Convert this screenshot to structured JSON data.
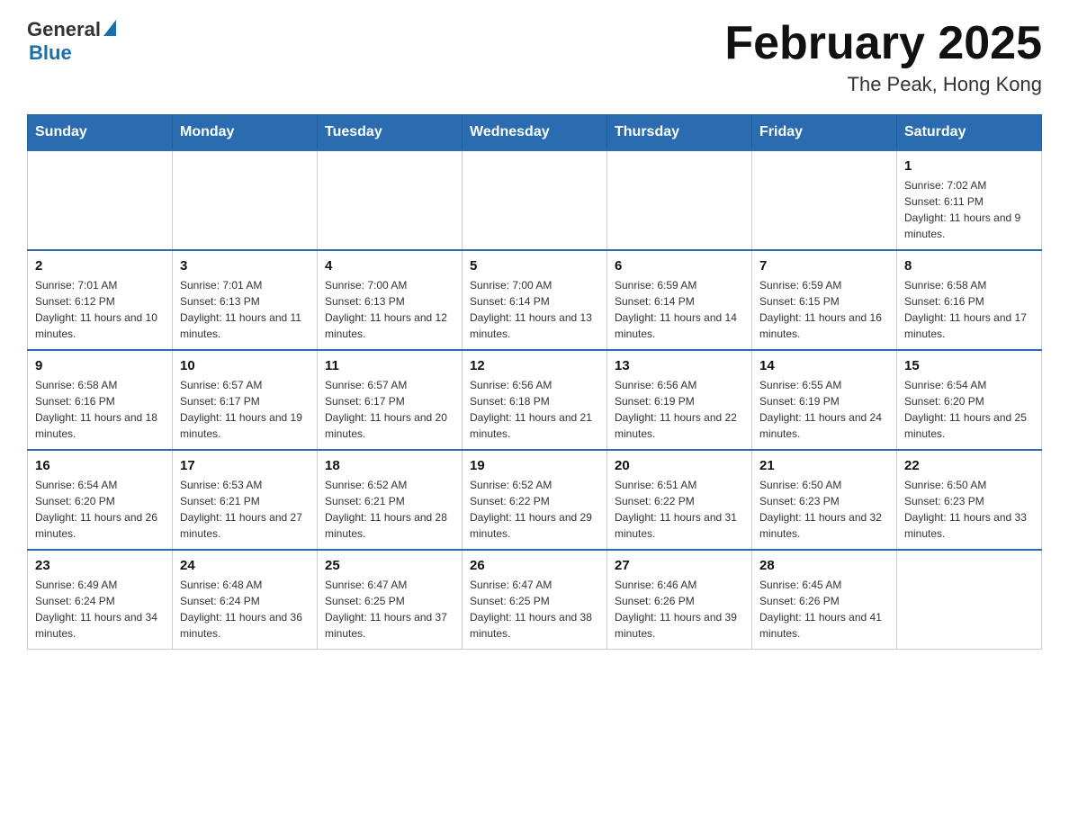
{
  "logo": {
    "general": "General",
    "blue": "Blue"
  },
  "header": {
    "month_year": "February 2025",
    "location": "The Peak, Hong Kong"
  },
  "days_of_week": [
    "Sunday",
    "Monday",
    "Tuesday",
    "Wednesday",
    "Thursday",
    "Friday",
    "Saturday"
  ],
  "weeks": [
    [
      {
        "day": "",
        "empty": true
      },
      {
        "day": "",
        "empty": true
      },
      {
        "day": "",
        "empty": true
      },
      {
        "day": "",
        "empty": true
      },
      {
        "day": "",
        "empty": true
      },
      {
        "day": "",
        "empty": true
      },
      {
        "day": "1",
        "sunrise": "7:02 AM",
        "sunset": "6:11 PM",
        "daylight": "11 hours and 9 minutes."
      }
    ],
    [
      {
        "day": "2",
        "sunrise": "7:01 AM",
        "sunset": "6:12 PM",
        "daylight": "11 hours and 10 minutes."
      },
      {
        "day": "3",
        "sunrise": "7:01 AM",
        "sunset": "6:13 PM",
        "daylight": "11 hours and 11 minutes."
      },
      {
        "day": "4",
        "sunrise": "7:00 AM",
        "sunset": "6:13 PM",
        "daylight": "11 hours and 12 minutes."
      },
      {
        "day": "5",
        "sunrise": "7:00 AM",
        "sunset": "6:14 PM",
        "daylight": "11 hours and 13 minutes."
      },
      {
        "day": "6",
        "sunrise": "6:59 AM",
        "sunset": "6:14 PM",
        "daylight": "11 hours and 14 minutes."
      },
      {
        "day": "7",
        "sunrise": "6:59 AM",
        "sunset": "6:15 PM",
        "daylight": "11 hours and 16 minutes."
      },
      {
        "day": "8",
        "sunrise": "6:58 AM",
        "sunset": "6:16 PM",
        "daylight": "11 hours and 17 minutes."
      }
    ],
    [
      {
        "day": "9",
        "sunrise": "6:58 AM",
        "sunset": "6:16 PM",
        "daylight": "11 hours and 18 minutes."
      },
      {
        "day": "10",
        "sunrise": "6:57 AM",
        "sunset": "6:17 PM",
        "daylight": "11 hours and 19 minutes."
      },
      {
        "day": "11",
        "sunrise": "6:57 AM",
        "sunset": "6:17 PM",
        "daylight": "11 hours and 20 minutes."
      },
      {
        "day": "12",
        "sunrise": "6:56 AM",
        "sunset": "6:18 PM",
        "daylight": "11 hours and 21 minutes."
      },
      {
        "day": "13",
        "sunrise": "6:56 AM",
        "sunset": "6:19 PM",
        "daylight": "11 hours and 22 minutes."
      },
      {
        "day": "14",
        "sunrise": "6:55 AM",
        "sunset": "6:19 PM",
        "daylight": "11 hours and 24 minutes."
      },
      {
        "day": "15",
        "sunrise": "6:54 AM",
        "sunset": "6:20 PM",
        "daylight": "11 hours and 25 minutes."
      }
    ],
    [
      {
        "day": "16",
        "sunrise": "6:54 AM",
        "sunset": "6:20 PM",
        "daylight": "11 hours and 26 minutes."
      },
      {
        "day": "17",
        "sunrise": "6:53 AM",
        "sunset": "6:21 PM",
        "daylight": "11 hours and 27 minutes."
      },
      {
        "day": "18",
        "sunrise": "6:52 AM",
        "sunset": "6:21 PM",
        "daylight": "11 hours and 28 minutes."
      },
      {
        "day": "19",
        "sunrise": "6:52 AM",
        "sunset": "6:22 PM",
        "daylight": "11 hours and 29 minutes."
      },
      {
        "day": "20",
        "sunrise": "6:51 AM",
        "sunset": "6:22 PM",
        "daylight": "11 hours and 31 minutes."
      },
      {
        "day": "21",
        "sunrise": "6:50 AM",
        "sunset": "6:23 PM",
        "daylight": "11 hours and 32 minutes."
      },
      {
        "day": "22",
        "sunrise": "6:50 AM",
        "sunset": "6:23 PM",
        "daylight": "11 hours and 33 minutes."
      }
    ],
    [
      {
        "day": "23",
        "sunrise": "6:49 AM",
        "sunset": "6:24 PM",
        "daylight": "11 hours and 34 minutes."
      },
      {
        "day": "24",
        "sunrise": "6:48 AM",
        "sunset": "6:24 PM",
        "daylight": "11 hours and 36 minutes."
      },
      {
        "day": "25",
        "sunrise": "6:47 AM",
        "sunset": "6:25 PM",
        "daylight": "11 hours and 37 minutes."
      },
      {
        "day": "26",
        "sunrise": "6:47 AM",
        "sunset": "6:25 PM",
        "daylight": "11 hours and 38 minutes."
      },
      {
        "day": "27",
        "sunrise": "6:46 AM",
        "sunset": "6:26 PM",
        "daylight": "11 hours and 39 minutes."
      },
      {
        "day": "28",
        "sunrise": "6:45 AM",
        "sunset": "6:26 PM",
        "daylight": "11 hours and 41 minutes."
      },
      {
        "day": "",
        "empty": true
      }
    ]
  ]
}
